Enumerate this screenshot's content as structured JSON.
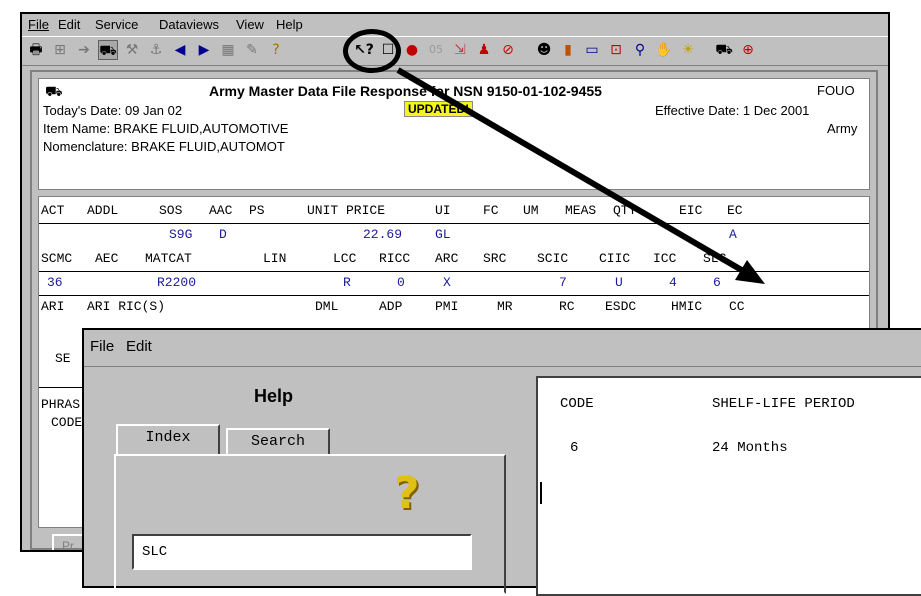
{
  "main_window": {
    "menu": [
      "File",
      "Edit",
      "Service",
      "Dataviews",
      "View",
      "Help"
    ],
    "toolbar_icons": [
      "print-icon",
      "hierarchy-icon",
      "route-icon",
      "truck-icon",
      "wrench-icon",
      "anchor-icon",
      "back-arrow-icon",
      "forward-arrow-icon",
      "grid-icon",
      "pen-icon",
      "question-icon",
      "whatsthis-help-icon",
      "window-icon",
      "apple-icon",
      "os-icon",
      "chart-icon",
      "pin-icon",
      "stop-icon",
      "face-icon",
      "bar-chart-icon",
      "monitor-icon",
      "cart-icon",
      "magnify-icon",
      "hand-icon",
      "bulb-icon",
      "tank-icon",
      "first-aid-icon"
    ],
    "title": "Army Master Data File Response for NSN  9150-01-102-9455",
    "classification": "FOUO",
    "badge": "UPDATED!",
    "todays_date": "Today's Date: 09 Jan 02",
    "item_name": "Item Name: BRAKE FLUID,AUTOMOTIVE",
    "nomenclature": "Nomenclature: BRAKE FLUID,AUTOMOT",
    "effective_date": "Effective Date: 1 Dec 2001",
    "service": "Army",
    "row1_headers": [
      "ACT",
      "ADDL",
      "SOS",
      "AAC",
      "PS",
      "UNIT PRICE",
      "UI",
      "FC",
      "UM",
      "MEAS",
      "QTY",
      "EIC",
      "EC"
    ],
    "row1_values": {
      "sos": "S9G",
      "aac": "D",
      "price": "22.69",
      "ui": "GL",
      "ec": "A"
    },
    "row2_headers": [
      "SCMC",
      "AEC",
      "MATCAT",
      "LIN",
      "LCC",
      "RICC",
      "ARC",
      "SRC",
      "SCIC",
      "CIIC",
      "ICC",
      "SLC"
    ],
    "row2_values": {
      "scmc": "36",
      "matcat": "R2200",
      "lcc": "R",
      "ricc": "0",
      "arc": "X",
      "scic": "7",
      "ciic": "U",
      "icc": "4",
      "slc": "6"
    },
    "row3_headers": [
      "ARI",
      "ARI RIC(S)",
      "DML",
      "ADP",
      "PMI",
      "MR",
      "RC",
      "ESDC",
      "HMIC",
      "CC"
    ],
    "partial_labels": [
      "SE",
      "PHRAS",
      "CODE",
      "Pr"
    ]
  },
  "help_window": {
    "menu": [
      "File",
      "Edit"
    ],
    "title": "Help",
    "tabs": [
      "Index",
      "Search"
    ],
    "index_value": "SLC",
    "table_headers": [
      "CODE",
      "SHELF-LIFE PERIOD"
    ],
    "table_rows": [
      {
        "code": "6",
        "period": "24 Months"
      }
    ]
  }
}
